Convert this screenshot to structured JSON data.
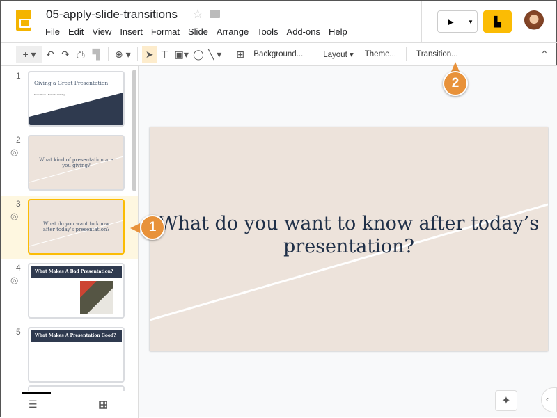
{
  "doc": {
    "title": "05-apply-slide-transitions"
  },
  "menu": [
    "File",
    "Edit",
    "View",
    "Insert",
    "Format",
    "Slide",
    "Arrange",
    "Tools",
    "Add-ons",
    "Help"
  ],
  "toolbar": {
    "background": "Background...",
    "layout": "Layout",
    "theme": "Theme...",
    "transition": "Transition..."
  },
  "slides": [
    {
      "num": "1",
      "title": "Giving a Great Presentation",
      "subtitle": "Kaela Pando · Networks Training"
    },
    {
      "num": "2",
      "title": "What kind of presentation are you giving?"
    },
    {
      "num": "3",
      "title": "What do you want to know after today's presentation?"
    },
    {
      "num": "4",
      "title": "What Makes A Bad Presentation?"
    },
    {
      "num": "5",
      "title": "What Makes A Presentation Good?"
    }
  ],
  "main_slide": {
    "text": "What do you want to know after today’s presentation?"
  },
  "callouts": [
    "1",
    "2"
  ],
  "colors": {
    "accent": "#f4b400",
    "callout": "#e8923a",
    "selected": "#fbbc04",
    "slide_bg": "#ede3db",
    "dark": "#2f3a4f"
  }
}
